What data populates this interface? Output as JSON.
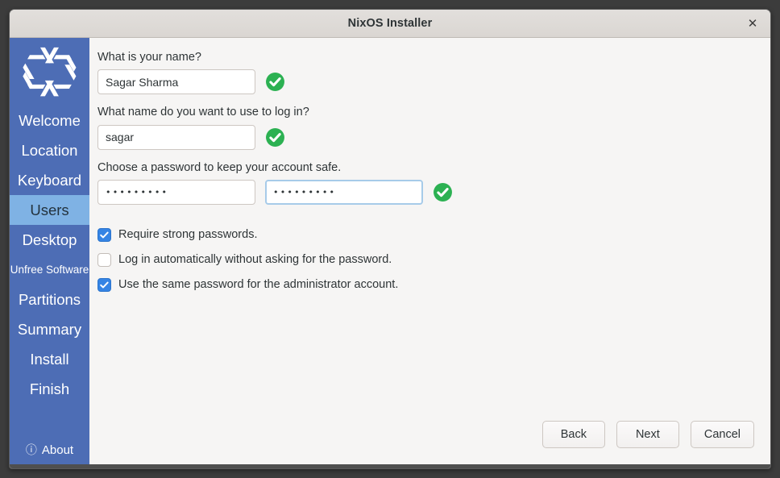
{
  "window": {
    "title": "NixOS Installer",
    "close_label": "✕"
  },
  "sidebar": {
    "logo_name": "nixos-snowflake-logo",
    "items": [
      {
        "label": "Welcome",
        "active": false
      },
      {
        "label": "Location",
        "active": false
      },
      {
        "label": "Keyboard",
        "active": false
      },
      {
        "label": "Users",
        "active": true
      },
      {
        "label": "Desktop",
        "active": false
      },
      {
        "label": "Unfree Software",
        "active": false
      },
      {
        "label": "Partitions",
        "active": false
      },
      {
        "label": "Summary",
        "active": false
      },
      {
        "label": "Install",
        "active": false
      },
      {
        "label": "Finish",
        "active": false
      }
    ],
    "about": {
      "label": "About",
      "icon": "ⓘ"
    }
  },
  "main": {
    "name_label": "What is your name?",
    "name_value": "Sagar Sharma",
    "name_placeholder": "",
    "login_label": "What name do you want to use to log in?",
    "login_value": "sagar",
    "login_placeholder": "",
    "password_label": "Choose a password to keep your account safe.",
    "password_value": "•••••••••",
    "password_confirm_value": "•••••••••",
    "checkboxes": [
      {
        "label": "Require strong passwords.",
        "checked": true
      },
      {
        "label": "Log in automatically without asking for the password.",
        "checked": false
      },
      {
        "label": "Use the same password for the administrator account.",
        "checked": true
      }
    ]
  },
  "footer": {
    "back_label": "Back",
    "next_label": "Next",
    "cancel_label": "Cancel"
  },
  "colors": {
    "sidebar_blue": "#4d6db5",
    "sidebar_active_blue": "#7fb2e4",
    "accent_blue": "#3584e4",
    "focus_blue": "#a7cbe9",
    "valid_green": "#2cb152",
    "content_bg": "#f6f5f4",
    "titlebar_bg": "#dedad6"
  }
}
